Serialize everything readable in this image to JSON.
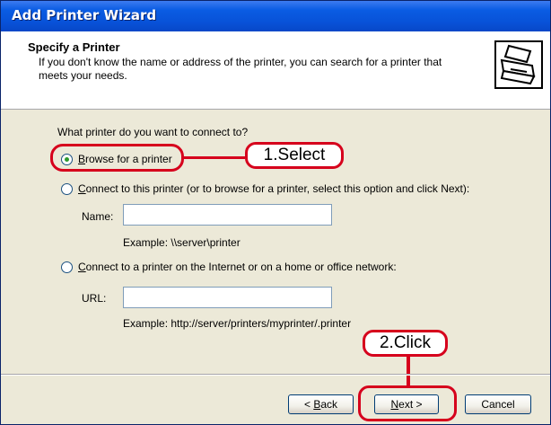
{
  "window": {
    "title": "Add Printer Wizard"
  },
  "header": {
    "title": "Specify a Printer",
    "subtitle": "If you don't know the name or address of the printer, you can search for a printer that meets your needs."
  },
  "question": "What printer do you want to connect to?",
  "options": {
    "browse": {
      "hotkey": "B",
      "rest": "rowse for a printer",
      "selected": true
    },
    "connect": {
      "hotkey": "C",
      "rest": "onnect to this printer (or to browse for a printer, select this option and click Next):"
    },
    "internet": {
      "hotkey": "C",
      "rest": "onnect to a printer on the Internet or on a home or office network:"
    }
  },
  "fields": {
    "name_label": "Name:",
    "name_value": "",
    "name_example": "Example: \\\\server\\printer",
    "url_label": "URL:",
    "url_value": "",
    "url_example": "Example: http://server/printers/myprinter/.printer"
  },
  "annotations": {
    "select": "1.Select",
    "click": "2.Click",
    "color": "#d6001c"
  },
  "buttons": {
    "back": {
      "prefix": "< ",
      "hotkey": "B",
      "rest": "ack"
    },
    "next": {
      "hotkey": "N",
      "rest": "ext >"
    },
    "cancel": "Cancel"
  },
  "icons": {
    "header": "printer-icon"
  }
}
